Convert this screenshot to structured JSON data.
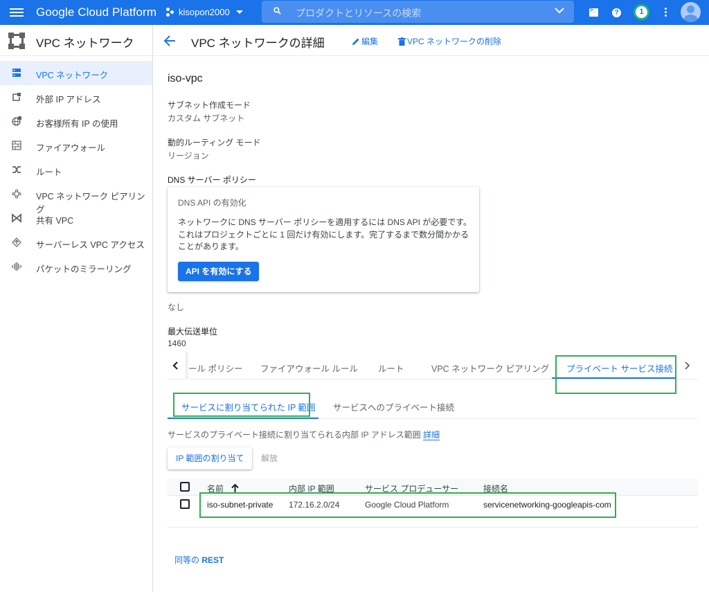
{
  "topbar": {
    "brand": "Google Cloud Platform",
    "project": "kisopon2000",
    "search_placeholder": "プロダクトとリソースの検索",
    "notification_count": "1",
    "color": "#1a73e8"
  },
  "sidebar": {
    "title": "VPC ネットワーク",
    "items": [
      {
        "label": "VPC ネットワーク",
        "icon": "vpc-network-icon",
        "active": true
      },
      {
        "label": "外部 IP アドレス",
        "icon": "external-ip-icon",
        "active": false
      },
      {
        "label": "お客様所有 IP の使用",
        "icon": "byoip-globe-icon",
        "active": false
      },
      {
        "label": "ファイアウォール",
        "icon": "firewall-icon",
        "active": false
      },
      {
        "label": "ルート",
        "icon": "routes-icon",
        "active": false
      },
      {
        "label": "VPC ネットワーク ピアリング",
        "icon": "peering-icon",
        "active": false
      },
      {
        "label": "共有 VPC",
        "icon": "shared-vpc-icon",
        "active": false
      },
      {
        "label": "サーバーレス VPC アクセス",
        "icon": "serverless-icon",
        "active": false
      },
      {
        "label": "パケットのミラーリング",
        "icon": "packet-mirroring-icon",
        "active": false
      }
    ]
  },
  "header": {
    "title": "VPC ネットワークの詳細",
    "edit_label": "編集",
    "delete_label": "VPC ネットワークの削除"
  },
  "details": {
    "network_name": "iso-vpc",
    "subnet_mode_label": "サブネット作成モード",
    "subnet_mode_value": "カスタム サブネット",
    "routing_mode_label": "動的ルーティング モード",
    "routing_mode_value": "リージョン",
    "dns_policy_label": "DNS サーバー ポリシー",
    "dns_card": {
      "title": "DNS API の有効化",
      "body": "ネットワークに DNS サーバー ポリシーを適用するには DNS API が必要です。これはプロジェクトごとに 1 回だけ有効にします。完了するまで数分間かかることがあります。",
      "button": "API を有効にする"
    },
    "dns_policy_value": "なし",
    "mtu_label": "最大伝送単位",
    "mtu_value": "1460"
  },
  "tabs": {
    "items": [
      {
        "label": "ール ポリシー",
        "active": false
      },
      {
        "label": "ファイアウォール ルール",
        "active": false
      },
      {
        "label": "ルート",
        "active": false
      },
      {
        "label": "VPC ネットワーク ピアリング",
        "active": false
      },
      {
        "label": "プライベート サービス接続",
        "active": true
      }
    ]
  },
  "subtabs": {
    "items": [
      {
        "label": "サービスに割り当てられた IP 範囲",
        "active": true
      },
      {
        "label": "サービスへのプライベート接続",
        "active": false
      }
    ]
  },
  "ip_ranges": {
    "description": "サービスのプライベート接続に割り当てられる内部 IP アドレス範囲",
    "learn_more": "詳細",
    "allocate_button": "IP 範囲の割り当て",
    "release_button": "解放",
    "columns": [
      "名前",
      "内部 IP 範囲",
      "サービス プロデューサー",
      "接続名"
    ],
    "sort_column": "名前",
    "rows": [
      {
        "name": "iso-subnet-private",
        "range": "172.16.2.0/24",
        "producer": "Google Cloud Platform",
        "connection": "servicenetworking-googleapis-com"
      }
    ]
  },
  "footer": {
    "rest_prefix": "同等の",
    "rest_label": "REST"
  },
  "highlight_color": "#2db14e"
}
